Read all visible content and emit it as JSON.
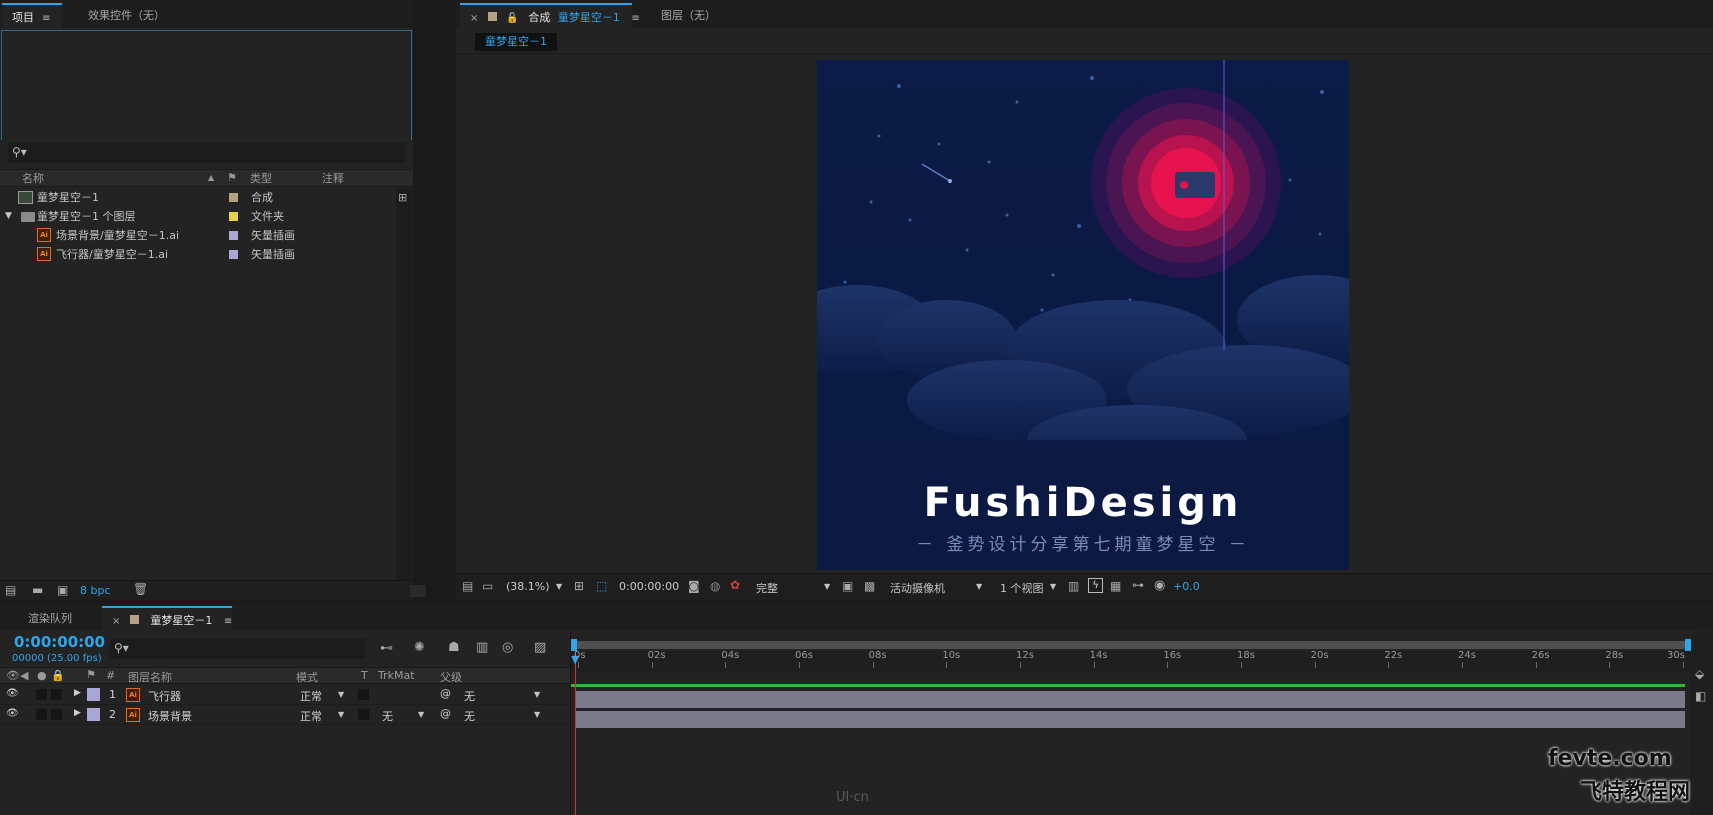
{
  "project_panel": {
    "tabs": [
      {
        "label": "项目"
      },
      {
        "label": "效果控件（无）"
      }
    ],
    "search_placeholder": "",
    "columns": {
      "name": "名称",
      "type": "类型",
      "comment": "注释"
    },
    "items": [
      {
        "name": "童梦星空－1",
        "type": "合成",
        "color": "#b5a182"
      },
      {
        "name": "童梦星空－1 个图层",
        "type": "文件夹",
        "color": "#e6d24a"
      },
      {
        "name": "场景背景/童梦星空－1.ai",
        "type": "矢量插画",
        "color": "#a9a7d6"
      },
      {
        "name": "飞行器/童梦星空－1.ai",
        "type": "矢量插画",
        "color": "#a9a7d6"
      }
    ],
    "bpc": "8 bpc"
  },
  "comp_viewer": {
    "tab_prefix": "合成",
    "tab_name": "童梦星空－1",
    "layer_tab": "图层（无）",
    "breadcrumb": "童梦星空－1",
    "artwork": {
      "title": "FushiDesign",
      "subtitle": "－ 釜势设计分享第七期童梦星空 －"
    },
    "toolbar": {
      "zoom": "(38.1%)",
      "timecode": "0:00:00:00",
      "resolution": "完整",
      "camera": "活动摄像机",
      "views": "1 个视图",
      "exposure": "+0.0"
    }
  },
  "timeline": {
    "tabs": [
      {
        "label": "渲染队列"
      },
      {
        "label": "童梦星空－1"
      }
    ],
    "timecode": "0:00:00:00",
    "frames": "00000 (25.00 fps)",
    "columns": {
      "num": "#",
      "layer_name": "图层名称",
      "mode": "模式",
      "t": "T",
      "trkmat": "TrkMat",
      "parent": "父级"
    },
    "layers": [
      {
        "num": "1",
        "name": "飞行器",
        "mode": "正常",
        "trkmat": "",
        "parent": "无"
      },
      {
        "num": "2",
        "name": "场景背景",
        "mode": "正常",
        "trkmat": "无",
        "parent": "无"
      }
    ],
    "ruler": [
      "0s",
      "02s",
      "04s",
      "06s",
      "08s",
      "10s",
      "12s",
      "14s",
      "16s",
      "18s",
      "20s",
      "22s",
      "24s",
      "26s",
      "28s",
      "30s"
    ]
  },
  "watermarks": {
    "fevte": "fevte.com",
    "fevte_cn": "飞特教程网",
    "uicn": "UI·cn"
  }
}
